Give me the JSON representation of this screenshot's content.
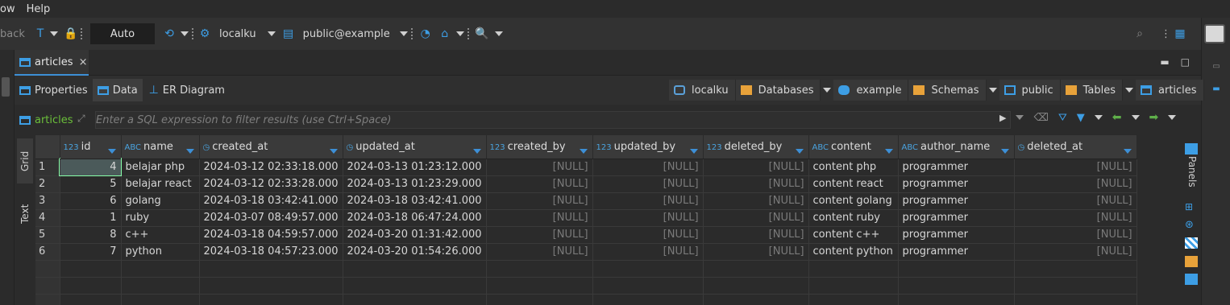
{
  "menubar": {
    "items": [
      "ow",
      "Help"
    ]
  },
  "toolbar": {
    "back_label": "back",
    "mode_value": "Auto",
    "connection": "localku",
    "schema": "public@example"
  },
  "editor": {
    "tab_label": "articles",
    "close_glyph": "×"
  },
  "subtabs": [
    {
      "label": "Properties"
    },
    {
      "label": "Data"
    },
    {
      "label": "ER Diagram"
    }
  ],
  "breadcrumbs": [
    {
      "label": "localku",
      "color": "#5aa0d8"
    },
    {
      "label": "Databases",
      "color": "#e8a23a"
    },
    {
      "label": "example",
      "color": "#3d9ee5"
    },
    {
      "label": "Schemas",
      "color": "#e8a23a"
    },
    {
      "label": "public",
      "color": "#3d9ee5"
    },
    {
      "label": "Tables",
      "color": "#e8a23a"
    },
    {
      "label": "articles",
      "color": "#3d9ee5"
    }
  ],
  "filter": {
    "table_label": "articles",
    "placeholder": "Enter a SQL expression to filter results (use Ctrl+Space)"
  },
  "view_tabs": {
    "grid": "Grid",
    "text": "Text"
  },
  "side_panel_label": "Panels",
  "columns": [
    {
      "name": "id",
      "type": "123"
    },
    {
      "name": "name",
      "type": "ABC"
    },
    {
      "name": "created_at",
      "type": "clock"
    },
    {
      "name": "updated_at",
      "type": "clock"
    },
    {
      "name": "created_by",
      "type": "123"
    },
    {
      "name": "updated_by",
      "type": "123"
    },
    {
      "name": "deleted_by",
      "type": "123"
    },
    {
      "name": "content",
      "type": "ABC"
    },
    {
      "name": "author_name",
      "type": "ABC"
    },
    {
      "name": "deleted_at",
      "type": "clock"
    }
  ],
  "rows": [
    {
      "n": "1",
      "id": "4",
      "name": "belajar php",
      "created_at": "2024-03-12 02:33:18.000",
      "updated_at": "2024-03-13 01:23:12.000",
      "created_by": "[NULL]",
      "updated_by": "[NULL]",
      "deleted_by": "[NULL]",
      "content": "content php",
      "author_name": "programmer",
      "deleted_at": "[NULL]"
    },
    {
      "n": "2",
      "id": "5",
      "name": "belajar react",
      "created_at": "2024-03-12 02:33:28.000",
      "updated_at": "2024-03-13 01:23:29.000",
      "created_by": "[NULL]",
      "updated_by": "[NULL]",
      "deleted_by": "[NULL]",
      "content": "content react",
      "author_name": "programmer",
      "deleted_at": "[NULL]"
    },
    {
      "n": "3",
      "id": "6",
      "name": "golang",
      "created_at": "2024-03-18 03:42:41.000",
      "updated_at": "2024-03-18 03:42:41.000",
      "created_by": "[NULL]",
      "updated_by": "[NULL]",
      "deleted_by": "[NULL]",
      "content": "content golang",
      "author_name": "programmer",
      "deleted_at": "[NULL]"
    },
    {
      "n": "4",
      "id": "1",
      "name": "ruby",
      "created_at": "2024-03-07 08:49:57.000",
      "updated_at": "2024-03-18 06:47:24.000",
      "created_by": "[NULL]",
      "updated_by": "[NULL]",
      "deleted_by": "[NULL]",
      "content": "content ruby",
      "author_name": "programmer",
      "deleted_at": "[NULL]"
    },
    {
      "n": "5",
      "id": "8",
      "name": "c++",
      "created_at": "2024-03-18 04:59:57.000",
      "updated_at": "2024-03-20 01:31:42.000",
      "created_by": "[NULL]",
      "updated_by": "[NULL]",
      "deleted_by": "[NULL]",
      "content": "content c++",
      "author_name": "programmer",
      "deleted_at": "[NULL]"
    },
    {
      "n": "6",
      "id": "7",
      "name": "python",
      "created_at": "2024-03-18 04:57:23.000",
      "updated_at": "2024-03-20 01:54:26.000",
      "created_by": "[NULL]",
      "updated_by": "[NULL]",
      "deleted_by": "[NULL]",
      "content": "content python",
      "author_name": "programmer",
      "deleted_at": "[NULL]"
    }
  ],
  "colors": {
    "accent": "#3d9ee5",
    "filter_label": "#6bbf3a",
    "null_text": "#7a7a7a"
  }
}
